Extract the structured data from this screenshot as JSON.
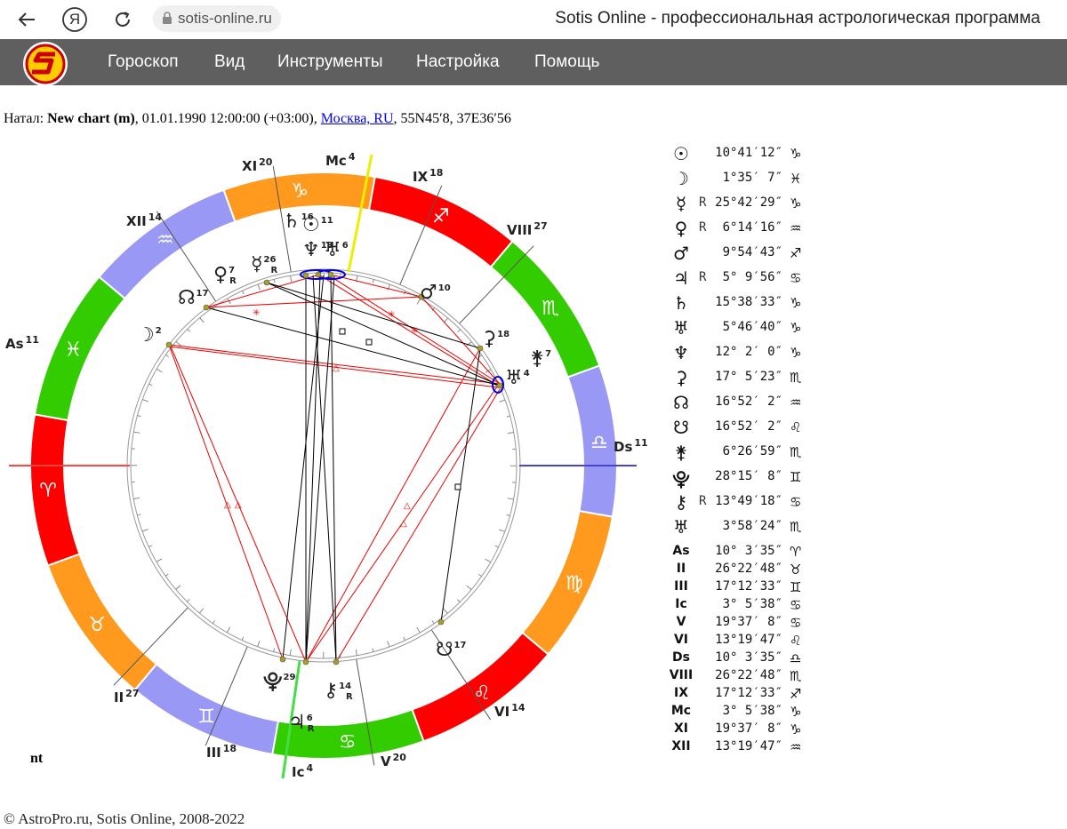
{
  "browser": {
    "back_icon": "back-arrow-icon",
    "yandex_icon": "Я",
    "reload_icon": "reload-icon",
    "url": "sotis-online.ru",
    "title": "Sotis Online - профессиональная астрологическая программа"
  },
  "menu": {
    "items": [
      "Гороскоп",
      "Вид",
      "Инструменты",
      "Настройка",
      "Помощь"
    ]
  },
  "natal": {
    "prefix": "Натал:",
    "chart_name": "New chart (m)",
    "datetime": ", 01.01.1990 12:00:00 (+03:00), ",
    "place": "Москва, RU",
    "coords": ", 55N45′8, 37E36′56"
  },
  "zodiac": {
    "signs": [
      "♈",
      "♉",
      "♊",
      "♋",
      "♌",
      "♍",
      "♎",
      "♏",
      "♐",
      "♑",
      "♒",
      "♓"
    ],
    "colors": [
      "#ff0000",
      "#ff9a1f",
      "#9999f5",
      "#33cc00",
      "#ff0000",
      "#ff9a1f",
      "#9999f5",
      "#33cc00",
      "#ff0000",
      "#ff9a1f",
      "#9999f5",
      "#33cc00"
    ]
  },
  "houses": [
    {
      "label": "As",
      "deg": "11"
    },
    {
      "label": "II",
      "deg": "27"
    },
    {
      "label": "III",
      "deg": "18"
    },
    {
      "label": "Ic",
      "deg": "4"
    },
    {
      "label": "V",
      "deg": "20"
    },
    {
      "label": "VI",
      "deg": "14"
    },
    {
      "label": "Ds",
      "deg": "11"
    },
    {
      "label": "VIII",
      "deg": "27"
    },
    {
      "label": "IX",
      "deg": "18"
    },
    {
      "label": "Mc",
      "deg": "4"
    },
    {
      "label": "XI",
      "deg": "20"
    },
    {
      "label": "XII",
      "deg": "14"
    }
  ],
  "chart_planets": [
    {
      "sym": "♄",
      "deg": "16",
      "r": ""
    },
    {
      "sym": "☉",
      "deg": "11",
      "r": ""
    },
    {
      "sym": "♆",
      "deg": "13",
      "r": ""
    },
    {
      "sym": "♅",
      "deg": "6",
      "r": ""
    },
    {
      "sym": "☿",
      "deg": "26",
      "r": "R"
    },
    {
      "sym": "♀",
      "deg": "7",
      "r": "R"
    },
    {
      "sym": "☊",
      "deg": "17",
      "r": ""
    },
    {
      "sym": "☽",
      "deg": "2",
      "r": ""
    },
    {
      "sym": "♂",
      "deg": "10",
      "r": ""
    },
    {
      "sym": "⚳",
      "deg": "18",
      "r": ""
    },
    {
      "sym": "⚵",
      "deg": "7",
      "r": ""
    },
    {
      "sym": "♅",
      "deg": "4",
      "r": ""
    },
    {
      "sym": "☋",
      "deg": "17",
      "r": ""
    },
    {
      "sym": "⯓",
      "deg": "29",
      "r": ""
    },
    {
      "sym": "⚷",
      "deg": "14",
      "r": "R"
    },
    {
      "sym": "♃",
      "deg": "6",
      "r": "R"
    }
  ],
  "planets": [
    {
      "sym": "☉",
      "retro": "",
      "pos": "10°41′12″",
      "sign": "♑"
    },
    {
      "sym": "☽",
      "retro": "",
      "pos": "1°35′ 7″",
      "sign": "♓"
    },
    {
      "sym": "☿",
      "retro": "R",
      "pos": "25°42′29″",
      "sign": "♑"
    },
    {
      "sym": "♀",
      "retro": "R",
      "pos": "6°14′16″",
      "sign": "♒"
    },
    {
      "sym": "♂",
      "retro": "",
      "pos": "9°54′43″",
      "sign": "♐"
    },
    {
      "sym": "♃",
      "retro": "R",
      "pos": "5° 9′56″",
      "sign": "♋"
    },
    {
      "sym": "♄",
      "retro": "",
      "pos": "15°38′33″",
      "sign": "♑"
    },
    {
      "sym": "♅",
      "retro": "",
      "pos": "5°46′40″",
      "sign": "♑"
    },
    {
      "sym": "♆",
      "retro": "",
      "pos": "12° 2′ 0″",
      "sign": "♑"
    },
    {
      "sym": "⚳",
      "retro": "",
      "pos": "17° 5′23″",
      "sign": "♏"
    },
    {
      "sym": "☊",
      "retro": "",
      "pos": "16°52′ 2″",
      "sign": "♒"
    },
    {
      "sym": "☋",
      "retro": "",
      "pos": "16°52′ 2″",
      "sign": "♌"
    },
    {
      "sym": "⚵",
      "retro": "",
      "pos": "6°26′59″",
      "sign": "♏"
    },
    {
      "sym": "⯓",
      "retro": "",
      "pos": "28°15′ 8″",
      "sign": "♊"
    },
    {
      "sym": "⚷",
      "retro": "R",
      "pos": "13°49′18″",
      "sign": "♋"
    },
    {
      "sym": "♅",
      "retro": "",
      "pos": "3°58′24″",
      "sign": "♏"
    },
    {
      "sym": "As",
      "retro": "",
      "pos": "10° 3′35″",
      "sign": "♈"
    },
    {
      "sym": "II",
      "retro": "",
      "pos": "26°22′48″",
      "sign": "♉"
    },
    {
      "sym": "III",
      "retro": "",
      "pos": "17°12′33″",
      "sign": "♊"
    },
    {
      "sym": "Ic",
      "retro": "",
      "pos": "3° 5′38″",
      "sign": "♋"
    },
    {
      "sym": "V",
      "retro": "",
      "pos": "19°37′ 8″",
      "sign": "♋"
    },
    {
      "sym": "VI",
      "retro": "",
      "pos": "13°19′47″",
      "sign": "♌"
    },
    {
      "sym": "Ds",
      "retro": "",
      "pos": "10° 3′35″",
      "sign": "♎"
    },
    {
      "sym": "VIII",
      "retro": "",
      "pos": "26°22′48″",
      "sign": "♏"
    },
    {
      "sym": "IX",
      "retro": "",
      "pos": "17°12′33″",
      "sign": "♐"
    },
    {
      "sym": "Mc",
      "retro": "",
      "pos": "3° 5′38″",
      "sign": "♑"
    },
    {
      "sym": "XI",
      "retro": "",
      "pos": "19°37′ 8″",
      "sign": "♑"
    },
    {
      "sym": "XII",
      "retro": "",
      "pos": "13°19′47″",
      "sign": "♒"
    }
  ],
  "nt_label": "nt",
  "footer": "© AstroPro.ru, Sotis Online, 2008-2022"
}
